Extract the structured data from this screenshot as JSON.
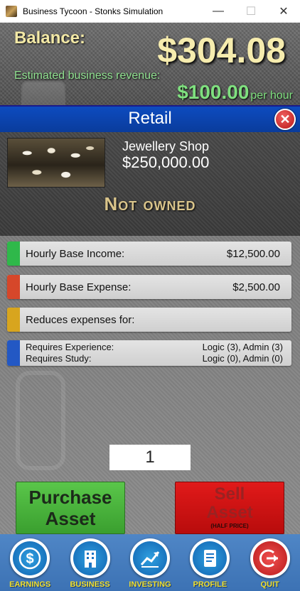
{
  "window": {
    "title": "Business Tycoon - Stonks Simulation",
    "minimize": "—",
    "maximize": "☐",
    "close": "✕"
  },
  "header": {
    "balance_label": "Balance:",
    "balance_value": "$304.08",
    "revenue_label": "Estimated business revenue:",
    "revenue_amount": "$100.00",
    "revenue_unit": "per hour"
  },
  "panel": {
    "title": "Retail",
    "close_symbol": "✕"
  },
  "business": {
    "name": "Jewellery Shop",
    "price": "$250,000.00",
    "status": "Not owned"
  },
  "stats": {
    "income_label": "Hourly Base Income:",
    "income_value": "$12,500.00",
    "expense_label": "Hourly Base Expense:",
    "expense_value": "$2,500.00",
    "reduces_label": "Reduces expenses for:",
    "reduces_value": "",
    "experience_label": "Requires Experience:",
    "experience_value": "Logic (3), Admin (3)",
    "study_label": "Requires Study:",
    "study_value": "Logic (0), Admin (0)"
  },
  "quantity": "1",
  "actions": {
    "purchase_line1": "Purchase",
    "purchase_line2": "Asset",
    "sell_line1": "Sell",
    "sell_line2": "Asset",
    "sell_note": "(HALF PRICE)"
  },
  "nav": {
    "earnings": "EARNINGS",
    "business": "BUSINESS",
    "investing": "INVESTING",
    "profile": "PROFILE",
    "quit": "QUIT"
  },
  "colors": {
    "income_bar": "#2fb84a",
    "expense_bar": "#d6472a",
    "reduces_bar": "#d8a51e",
    "requires_bar": "#2358c4"
  },
  "icons": {
    "earnings": "dollar-coin-icon",
    "business": "building-icon",
    "investing": "chart-up-icon",
    "profile": "document-icon",
    "quit": "power-exit-icon"
  }
}
